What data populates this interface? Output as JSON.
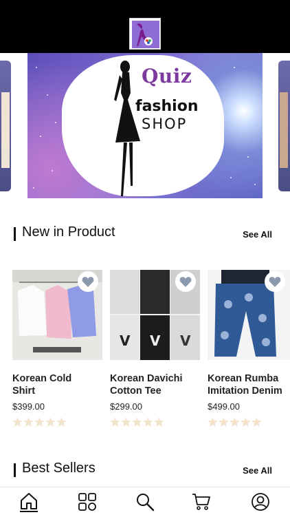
{
  "header": {
    "logo_name": "quiz-fashion-logo"
  },
  "banner": {
    "title_line1": "Quiz",
    "title_line2": "fashion",
    "title_line3": "SHOP"
  },
  "new_in": {
    "title": "New in Product",
    "see_all": "See All",
    "products": [
      {
        "name_line1": "Korean Cold",
        "name_line2": "Shirt",
        "price": "$399.00",
        "rating": 0
      },
      {
        "name_line1": "Korean Davichi",
        "name_line2": "Cotton Tee",
        "price": "$299.00",
        "rating": 0
      },
      {
        "name_line1": "Korean Rumba",
        "name_line2": "Imitation Denim",
        "price": "$499.00",
        "rating": 0
      }
    ]
  },
  "best_sellers": {
    "title": "Best Sellers",
    "see_all": "See All"
  },
  "nav": {
    "items": [
      "home-icon",
      "categories-icon",
      "search-icon",
      "cart-icon",
      "profile-icon"
    ],
    "active": "home-icon"
  },
  "colors": {
    "star_empty": "#f3e2cc",
    "heart": "#8a9bb0",
    "brand_purple": "#7d3a9e"
  }
}
